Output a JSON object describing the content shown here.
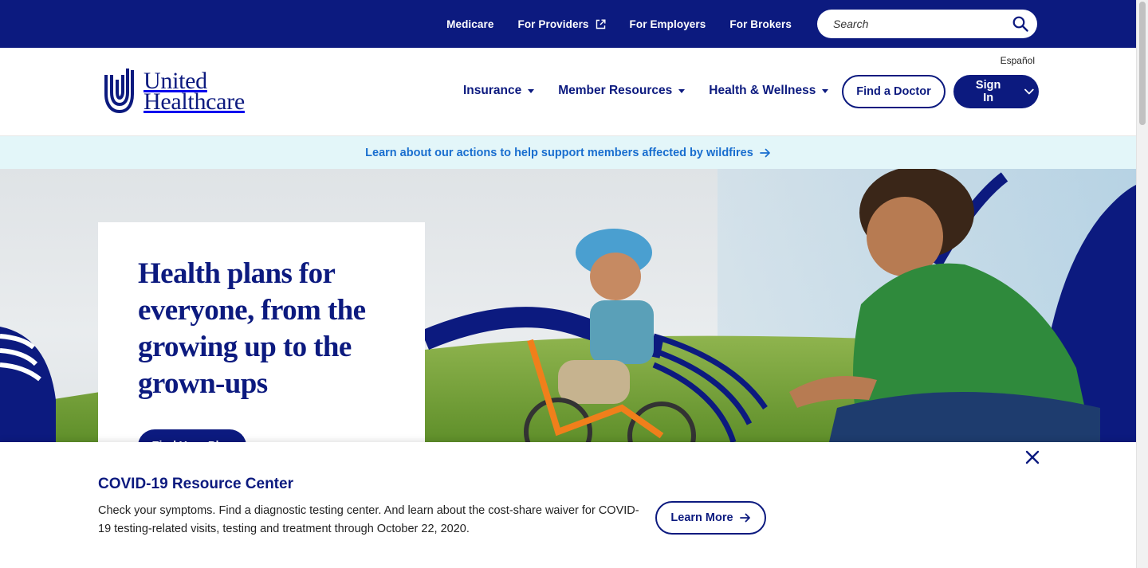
{
  "utility_nav": {
    "links": [
      {
        "label": "Medicare"
      },
      {
        "label": "For Providers",
        "icon": "external-link-icon"
      },
      {
        "label": "For Employers"
      },
      {
        "label": "For Brokers"
      }
    ],
    "search": {
      "placeholder": "Search",
      "icon": "search-icon"
    }
  },
  "header": {
    "logo_line1": "United",
    "logo_line2": "Healthcare",
    "language_link": "Español",
    "nav": [
      {
        "label": "Insurance"
      },
      {
        "label": "Member Resources"
      },
      {
        "label": "Health & Wellness"
      }
    ],
    "find_doctor_label": "Find a Doctor",
    "sign_in_label": "Sign In"
  },
  "alert": {
    "text": "Learn about our actions to help support members affected by wildfires"
  },
  "hero": {
    "headline": "Health plans for everyone, from the growing up to the grown-ups",
    "cta_label": "Find Your Plan"
  },
  "covid_banner": {
    "title": "COVID-19 Resource Center",
    "body": "Check your symptoms. Find a diagnostic testing center. And learn about the cost-share waiver for COVID-19 testing-related visits, testing and treatment through October 22, 2020.",
    "button_label": "Learn More"
  },
  "colors": {
    "brand_navy": "#0c1a7f",
    "link_blue": "#196ecf",
    "alert_bg": "#e3f6f9"
  }
}
